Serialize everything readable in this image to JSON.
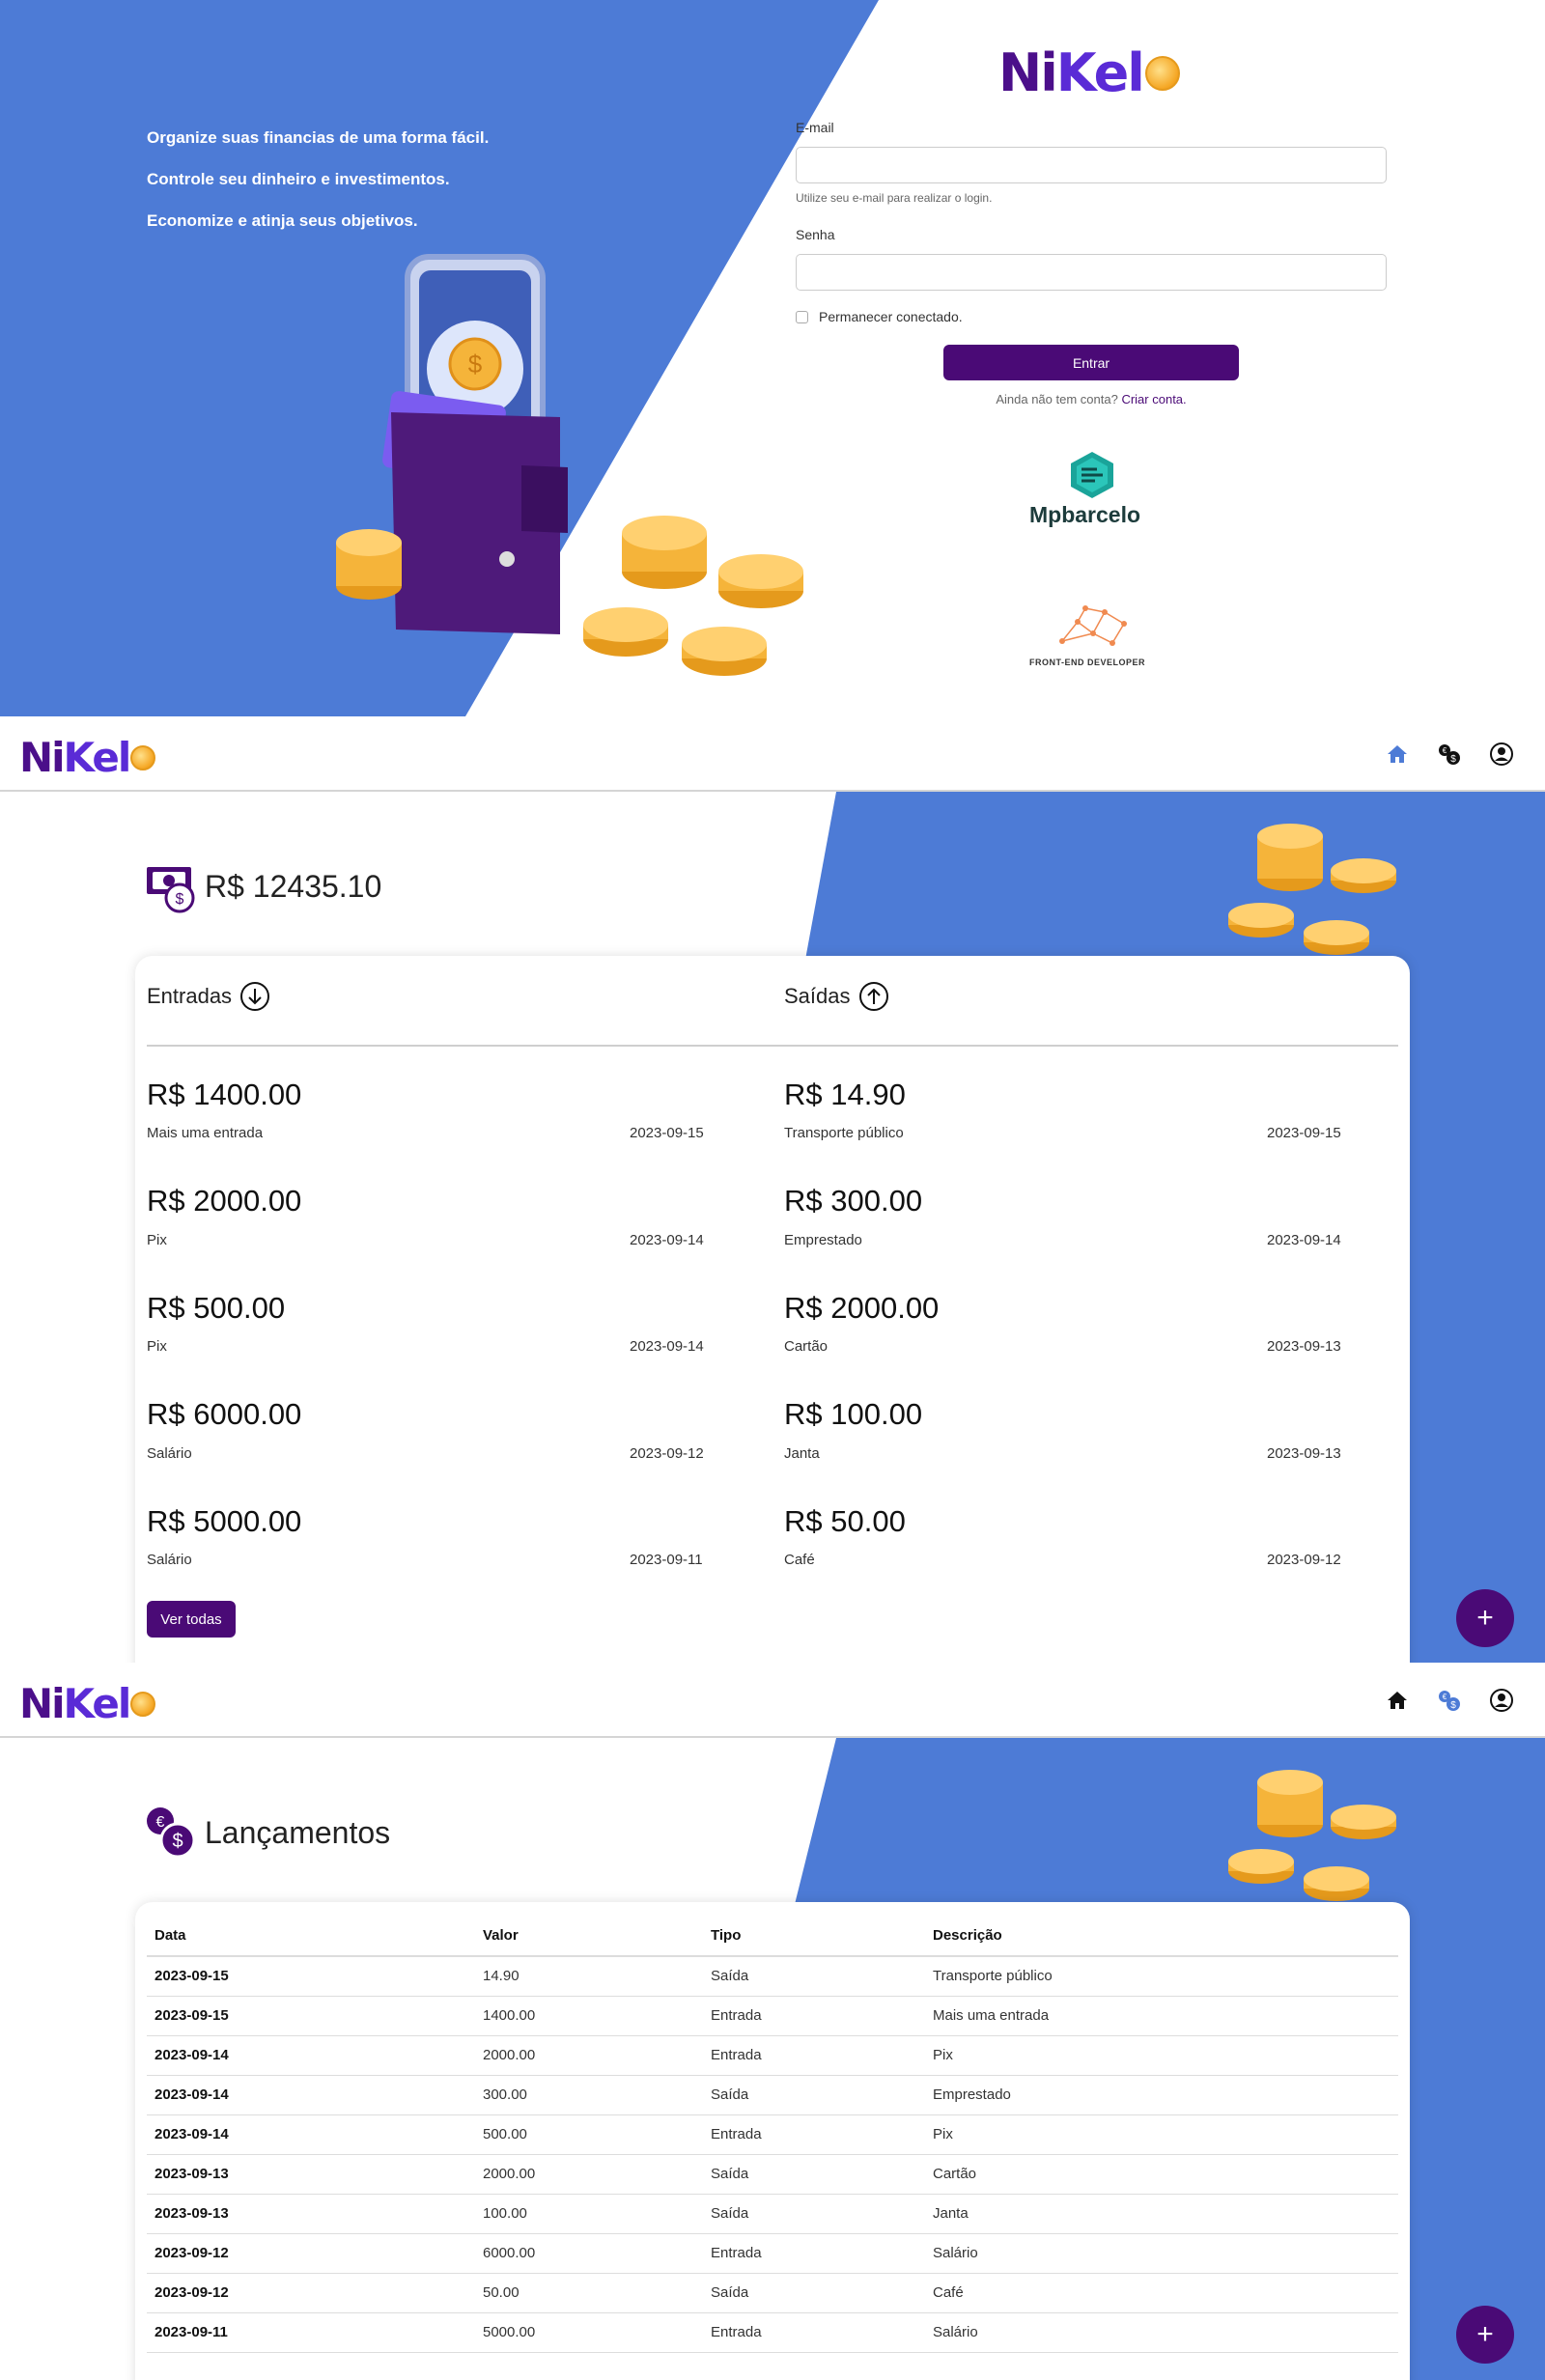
{
  "login": {
    "taglines": [
      "Organize suas financias de uma forma fácil.",
      "Controle seu dinheiro e investimentos.",
      "Economize e atinja seus objetivos."
    ],
    "logo_part1": "Ni",
    "logo_part2": "Kel",
    "email_label": "E-mail",
    "email_value": "",
    "email_help": "Utilize seu e-mail para realizar o login.",
    "password_label": "Senha",
    "password_value": "",
    "remember_label": "Permanecer conectado.",
    "remember_checked": false,
    "submit_label": "Entrar",
    "signup_prompt": "Ainda não tem conta?",
    "signup_link": "Criar conta.",
    "brand_name": "Mpbarcelo",
    "dev_label": "FRONT-END DEVELOPER"
  },
  "home": {
    "logo_part1": "Ni",
    "logo_part2": "Kel",
    "balance": "R$ 12435.10",
    "entradas_title": "Entradas",
    "saidas_title": "Saídas",
    "entradas": [
      {
        "amount": "R$ 1400.00",
        "desc": "Mais uma entrada",
        "date": "2023-09-15"
      },
      {
        "amount": "R$ 2000.00",
        "desc": "Pix",
        "date": "2023-09-14"
      },
      {
        "amount": "R$ 500.00",
        "desc": "Pix",
        "date": "2023-09-14"
      },
      {
        "amount": "R$ 6000.00",
        "desc": "Salário",
        "date": "2023-09-12"
      },
      {
        "amount": "R$ 5000.00",
        "desc": "Salário",
        "date": "2023-09-11"
      }
    ],
    "saidas": [
      {
        "amount": "R$ 14.90",
        "desc": "Transporte público",
        "date": "2023-09-15"
      },
      {
        "amount": "R$ 300.00",
        "desc": "Emprestado",
        "date": "2023-09-14"
      },
      {
        "amount": "R$ 2000.00",
        "desc": "Cartão",
        "date": "2023-09-13"
      },
      {
        "amount": "R$ 100.00",
        "desc": "Janta",
        "date": "2023-09-13"
      },
      {
        "amount": "R$ 50.00",
        "desc": "Café",
        "date": "2023-09-12"
      }
    ],
    "ver_todas": "Ver todas",
    "fab": "+"
  },
  "transactions": {
    "logo_part1": "Ni",
    "logo_part2": "Kel",
    "title": "Lançamentos",
    "headers": [
      "Data",
      "Valor",
      "Tipo",
      "Descrição"
    ],
    "rows": [
      [
        "2023-09-15",
        "14.90",
        "Saída",
        "Transporte público"
      ],
      [
        "2023-09-15",
        "1400.00",
        "Entrada",
        "Mais uma entrada"
      ],
      [
        "2023-09-14",
        "2000.00",
        "Entrada",
        "Pix"
      ],
      [
        "2023-09-14",
        "300.00",
        "Saída",
        "Emprestado"
      ],
      [
        "2023-09-14",
        "500.00",
        "Entrada",
        "Pix"
      ],
      [
        "2023-09-13",
        "2000.00",
        "Saída",
        "Cartão"
      ],
      [
        "2023-09-13",
        "100.00",
        "Saída",
        "Janta"
      ],
      [
        "2023-09-12",
        "6000.00",
        "Entrada",
        "Salário"
      ],
      [
        "2023-09-12",
        "50.00",
        "Saída",
        "Café"
      ],
      [
        "2023-09-11",
        "5000.00",
        "Entrada",
        "Salário"
      ]
    ],
    "fab": "+"
  },
  "nav_icons": [
    "home-icon",
    "coins-exchange-icon",
    "user-circle-icon"
  ],
  "colors": {
    "brand_blue": "#4d7bd6",
    "brand_purple": "#4a0a76",
    "coin_gold": "#f5a623"
  }
}
